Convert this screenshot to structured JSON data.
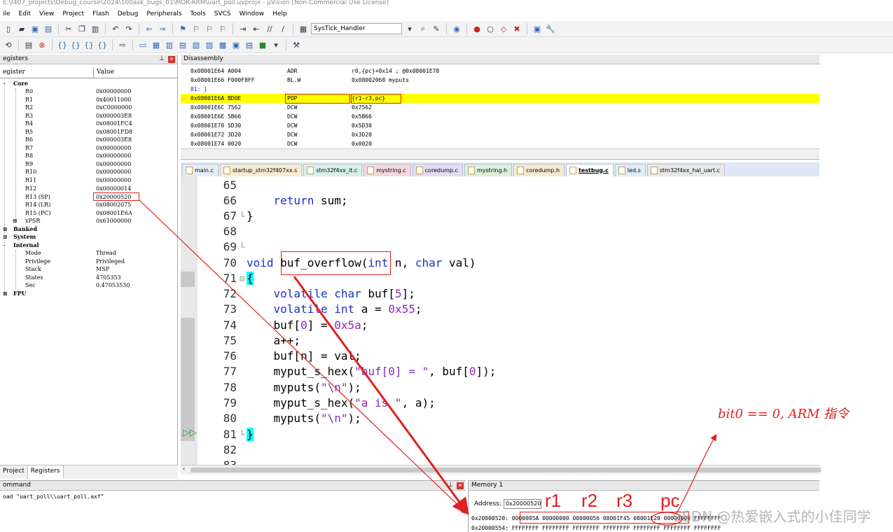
{
  "window": {
    "title": "E:\\f407_projects\\Debug_course\\2024\\100ask_bugs_01\\MDK-ARM\\uart_poll.uvprojx - µVision [Non-Commercial Use License]"
  },
  "menu": [
    "ile",
    "Edit",
    "View",
    "Project",
    "Flash",
    "Debug",
    "Peripherals",
    "Tools",
    "SVCS",
    "Window",
    "Help"
  ],
  "toolbar": {
    "function_combo": "SysTick_Handler"
  },
  "registers_panel": {
    "title": "egisters",
    "col_register": "egister",
    "col_value": "Value",
    "core_label": "Core",
    "registers": [
      {
        "name": "R0",
        "value": "0x00000000"
      },
      {
        "name": "R1",
        "value": "0x40011000"
      },
      {
        "name": "R2",
        "value": "0xC0000000"
      },
      {
        "name": "R3",
        "value": "0x000003E8"
      },
      {
        "name": "R4",
        "value": "0x08001FC4"
      },
      {
        "name": "R5",
        "value": "0x08001FD8"
      },
      {
        "name": "R6",
        "value": "0x000003E8"
      },
      {
        "name": "R7",
        "value": "0x00000000"
      },
      {
        "name": "R8",
        "value": "0x00000000"
      },
      {
        "name": "R9",
        "value": "0x00000000"
      },
      {
        "name": "R10",
        "value": "0x00000000"
      },
      {
        "name": "R11",
        "value": "0x00000000"
      },
      {
        "name": "R12",
        "value": "0x00000014"
      },
      {
        "name": "R13 (SP)",
        "value": "0x20000520"
      },
      {
        "name": "R14 (LR)",
        "value": "0x08002075"
      },
      {
        "name": "R15 (PC)",
        "value": "0x08001E6A"
      },
      {
        "name": "xPSR",
        "value": "0x61000000"
      }
    ],
    "groups": [
      "Banked",
      "System",
      "Internal"
    ],
    "internal": [
      {
        "name": "Mode",
        "value": "Thread"
      },
      {
        "name": "Privilege",
        "value": "Privileged"
      },
      {
        "name": "Stack",
        "value": "MSP"
      },
      {
        "name": "States",
        "value": "4705353"
      },
      {
        "name": "Sec",
        "value": "0.47053530"
      }
    ],
    "fpu_label": "FPU",
    "tabs": [
      "Project",
      "Registers"
    ]
  },
  "disassembly": {
    "title": "Disassembly",
    "lines": [
      {
        "addr": "0x08001E64 A004",
        "op": "ADR",
        "args": "r0,{pc}+0x14  ; @0x08001E78"
      },
      {
        "addr": "0x08001E66 F000F8FF",
        "op": "BL.W",
        "args": "0x08002068 myputs"
      },
      {
        "addr": "    81: }",
        "op": "",
        "args": ""
      },
      {
        "addr": "0x08001E6A BD0E",
        "op": "POP",
        "args": "{r1-r3,pc}"
      },
      {
        "addr": "0x08001E6C 7562",
        "op": "DCW",
        "args": "0x7562"
      },
      {
        "addr": "0x08001E6E 5B66",
        "op": "DCW",
        "args": "0x5B66"
      },
      {
        "addr": "0x08001E70 5D30",
        "op": "DCW",
        "args": "0x5D30"
      },
      {
        "addr": "0x08001E72 3D20",
        "op": "DCW",
        "args": "0x3D20"
      },
      {
        "addr": "0x08001E74 0020",
        "op": "DCW",
        "args": "0x0020"
      }
    ]
  },
  "file_tabs": [
    "main.c",
    "startup_stm32f407xx.s",
    "stm32f4xx_it.c",
    "mystring.c",
    "coredump.c",
    "mystring.h",
    "coredump.h",
    "testbug.c",
    "led.s",
    "stm32f4xx_hal_uart.c"
  ],
  "active_tab": "testbug.c",
  "editor": {
    "lines": [
      {
        "n": "65",
        "code": ""
      },
      {
        "n": "66",
        "code": "    return sum;"
      },
      {
        "n": "67",
        "code": "}"
      },
      {
        "n": "68",
        "code": ""
      },
      {
        "n": "69",
        "code": ""
      },
      {
        "n": "70",
        "code": "void buf_overflow(int n, char val)"
      },
      {
        "n": "71",
        "code": "{"
      },
      {
        "n": "72",
        "code": "    volatile char buf[5];"
      },
      {
        "n": "73",
        "code": "    volatile int a = 0x55;"
      },
      {
        "n": "74",
        "code": "    buf[0] = 0x5a;"
      },
      {
        "n": "75",
        "code": "    a++;"
      },
      {
        "n": "76",
        "code": "    buf[n] = val;"
      },
      {
        "n": "77",
        "code": "    myput_s_hex(\"buf[0] = \", buf[0]);"
      },
      {
        "n": "78",
        "code": "    myputs(\"\\n\");"
      },
      {
        "n": "79",
        "code": "    myput_s_hex(\"a is \", a);"
      },
      {
        "n": "80",
        "code": "    myputs(\"\\n\");"
      },
      {
        "n": "81",
        "code": "}"
      },
      {
        "n": "82",
        "code": ""
      },
      {
        "n": "83",
        "code": ""
      }
    ]
  },
  "command_panel": {
    "title": "ommand",
    "text": "oad \"uart_poll\\\\uart_poll.axf\""
  },
  "memory_panel": {
    "title": "Memory 1",
    "address_label": "Address:",
    "address_value": "0x20000520",
    "row1": "0x20000520:  0000005A 00000000 00000056 08001F45 08001E20 00000000 FFFFFFFF",
    "row2": "0x20000554:  FFFFFFFF FFFFFFFF FFFFFFFF FFFFFFFF FFFFFFFF FFFFFFFF FFFFFFFF"
  },
  "annotations": {
    "r1": "r1",
    "r2": "r2",
    "r3": "r3",
    "pc": "pc",
    "handnote": "bit0 == 0,  ARM 指令",
    "watermark": "CSDN @热爱嵌入式的小佳同学"
  },
  "colors": {
    "current_line": "#ffff00",
    "annotation": "#e02020",
    "keyword": "#1f2fc8",
    "literal": "#8a2ab8"
  }
}
